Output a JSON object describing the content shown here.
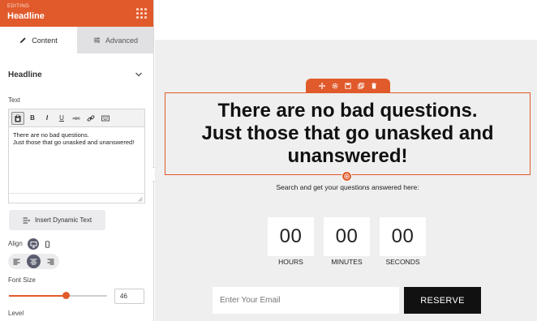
{
  "panel": {
    "editing_label": "EDITING",
    "title": "Headline",
    "tabs": [
      {
        "label": "Content",
        "icon": "pencil-icon",
        "active": true
      },
      {
        "label": "Advanced",
        "icon": "sliders-icon",
        "active": false
      }
    ],
    "section_title": "Headline",
    "text_label": "Text",
    "editor_content": "There are no bad questions.\nJust those that go unasked and unanswered!",
    "toolbar": [
      "paste-icon",
      "bold-icon",
      "italic-icon",
      "underline-icon",
      "strikethrough-icon",
      "link-icon",
      "keyboard-icon"
    ],
    "insert_dynamic_text": "Insert Dynamic Text",
    "align_label": "Align",
    "font_size_label": "Font Size",
    "font_size_value": "46",
    "font_size_slider_fraction": 0.58,
    "level_label": "Level"
  },
  "canvas": {
    "headline": "There are no bad questions.\nJust those that go unasked and\nunanswered!",
    "subtext": "Search and get your questions answered here:",
    "countdown": [
      {
        "value": "00",
        "label": "HOURS"
      },
      {
        "value": "00",
        "label": "MINUTES"
      },
      {
        "value": "00",
        "label": "SECONDS"
      }
    ],
    "email_placeholder": "Enter Your Email",
    "reserve_label": "RESERVE"
  },
  "colors": {
    "accent": "#e15a2b",
    "canvas_bg": "#efefef",
    "button_dark": "#111111"
  }
}
